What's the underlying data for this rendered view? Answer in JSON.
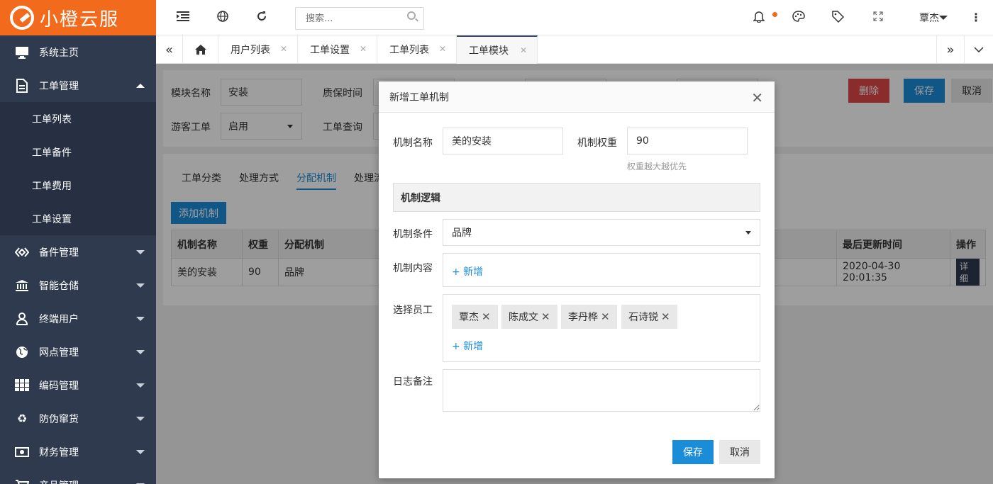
{
  "app": {
    "logo_text": "小橙云服"
  },
  "sidebar": {
    "items": [
      {
        "label": "系统主页",
        "icon": "monitor-icon"
      },
      {
        "label": "工单管理",
        "icon": "document-icon",
        "open": true,
        "children": [
          "工单列表",
          "工单备件",
          "工单费用",
          "工单设置"
        ]
      },
      {
        "label": "备件管理",
        "icon": "diamond-icon"
      },
      {
        "label": "智能仓储",
        "icon": "bank-icon"
      },
      {
        "label": "终端用户",
        "icon": "user-icon"
      },
      {
        "label": "网点管理",
        "icon": "globe-icon"
      },
      {
        "label": "编码管理",
        "icon": "grid-icon"
      },
      {
        "label": "防伪窜货",
        "icon": "recycle-icon"
      },
      {
        "label": "财务管理",
        "icon": "money-icon"
      },
      {
        "label": "产品管理",
        "icon": "cart-icon"
      }
    ]
  },
  "topbar": {
    "search_placeholder": "搜索...",
    "user_name": "覃杰"
  },
  "tabs": [
    {
      "label": "用户列表"
    },
    {
      "label": "工单设置"
    },
    {
      "label": "工单列表"
    },
    {
      "label": "工单模块",
      "active": true
    }
  ],
  "main": {
    "form": {
      "module_name_label": "模块名称",
      "module_name_value": "安装",
      "warranty_label": "质保时间",
      "guest_label": "游客工单",
      "guest_value": "启用",
      "query_label": "工单查询"
    },
    "actions": {
      "delete": "删除",
      "save": "保存",
      "cancel": "取消"
    },
    "subtabs": [
      "工单分类",
      "处理方式",
      "分配机制",
      "处理流"
    ],
    "add_button": "添加机制",
    "table": {
      "headers": [
        "机制名称",
        "权重",
        "分配机制",
        "最后更新时间",
        "操作"
      ],
      "rows": [
        {
          "name": "美的安装",
          "weight": "90",
          "mechanism": "品牌",
          "updated": "2020-04-30 20:01:35",
          "action": "详细"
        }
      ]
    }
  },
  "modal": {
    "title": "新增工单机制",
    "name_label": "机制名称",
    "name_value": "美的安装",
    "weight_label": "机制权重",
    "weight_value": "90",
    "weight_hint": "权重越大越优先",
    "section_title": "机制逻辑",
    "condition_label": "机制条件",
    "condition_value": "品牌",
    "content_label": "机制内容",
    "add_link": "+ 新增",
    "staff_label": "选择员工",
    "staff": [
      "覃杰",
      "陈成文",
      "李丹桦",
      "石诗锐"
    ],
    "log_label": "日志备注",
    "save": "保存",
    "cancel": "取消"
  }
}
